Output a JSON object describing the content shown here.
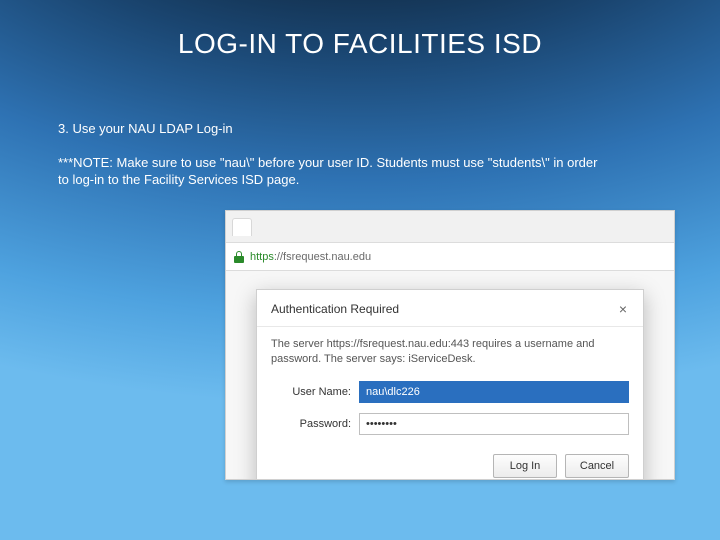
{
  "title": "LOG-IN TO FACILITIES ISD",
  "step": "3. Use your NAU LDAP Log-in",
  "note": "***NOTE: Make sure to use \"nau\\\" before your user ID. Students must use \"students\\\" in order to log-in to the Facility Services ISD page.",
  "browser": {
    "host": "https",
    "url": "://fsrequest.nau.edu"
  },
  "dialog": {
    "title": "Authentication Required",
    "message": "The server https://fsrequest.nau.edu:443 requires a username and password. The server says: iServiceDesk.",
    "user_label": "User Name:",
    "user_value": "nau\\dlc226",
    "pass_label": "Password:",
    "pass_value": "••••••••",
    "login_btn": "Log In",
    "cancel_btn": "Cancel",
    "close": "×"
  }
}
